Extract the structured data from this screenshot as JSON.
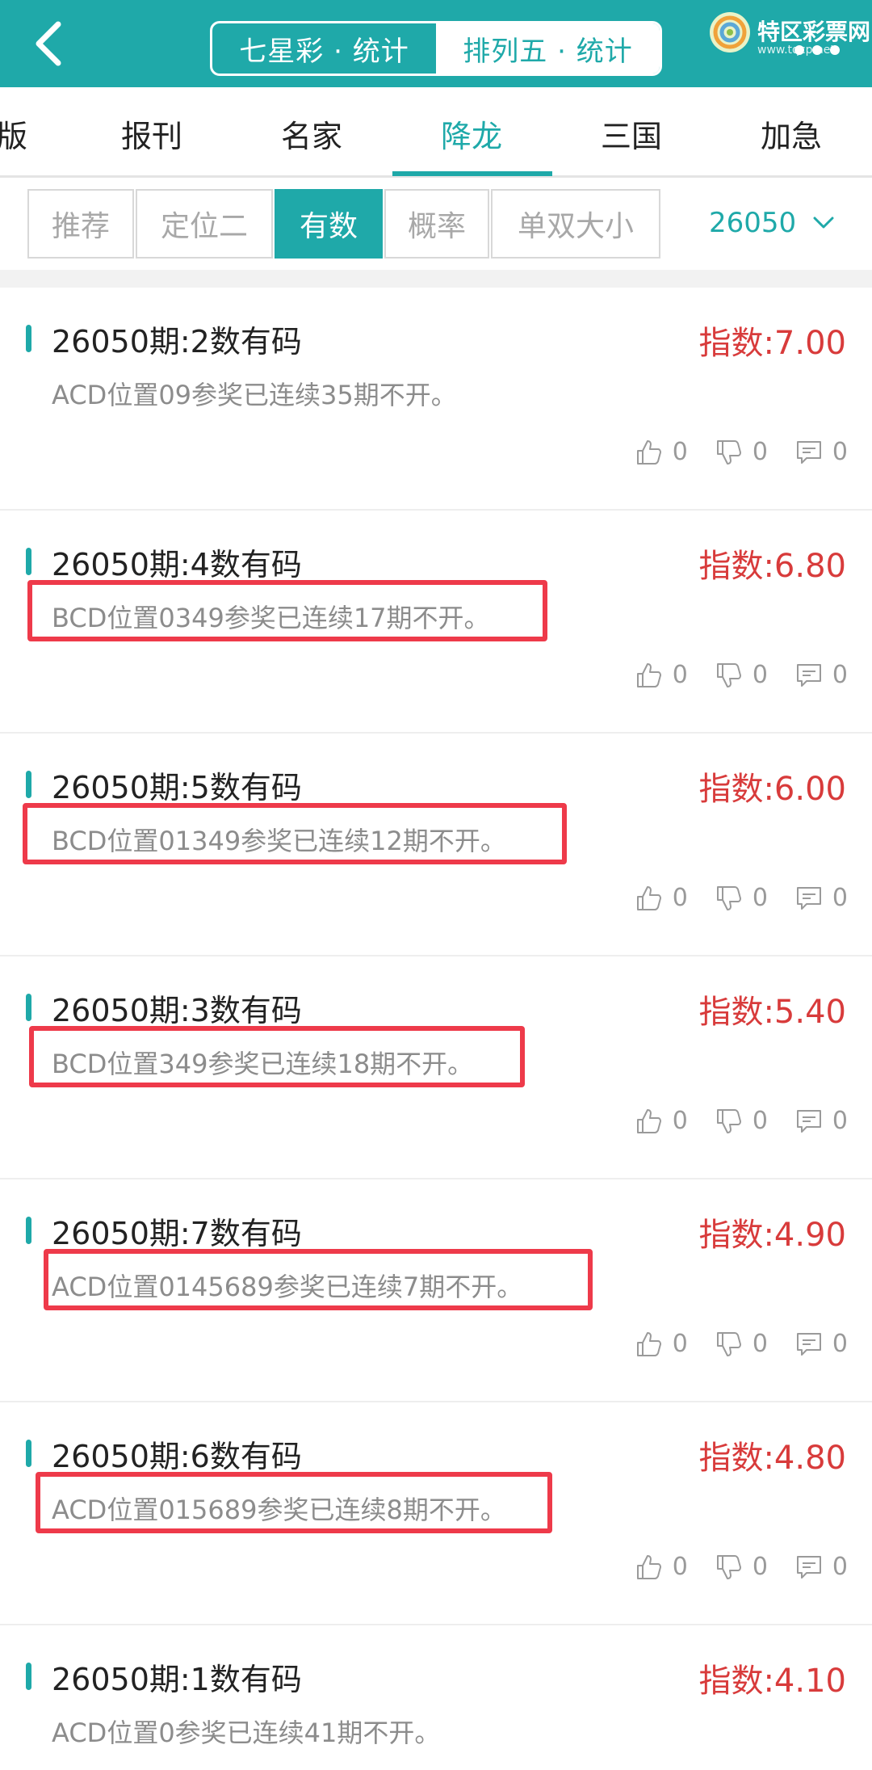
{
  "header": {
    "segments": [
      {
        "label": "七星彩 · 统计",
        "active": false
      },
      {
        "label": "排列五 · 统计",
        "active": true
      }
    ],
    "brand": {
      "name": "特区彩票网",
      "url": "www.tqcp.net"
    }
  },
  "nav": {
    "items": [
      "版",
      "报刊",
      "名家",
      "降龙",
      "三国",
      "加急"
    ],
    "active_index": 3
  },
  "filters": {
    "tabs": [
      "推荐",
      "定位二",
      "有数",
      "概率",
      "单双大小"
    ],
    "active_index": 2,
    "issue": "26050"
  },
  "colors": {
    "accent": "#1fa9a9",
    "index": "#d83b3b",
    "highlight": "#ee3a4a"
  },
  "items": [
    {
      "title": "26050期:2数有码",
      "index": "指数:7.00",
      "desc": "ACD位置09参奖已连续35期不开。",
      "likes": "0",
      "dislikes": "0",
      "comments": "0",
      "highlighted": false
    },
    {
      "title": "26050期:4数有码",
      "index": "指数:6.80",
      "desc": "BCD位置0349参奖已连续17期不开。",
      "likes": "0",
      "dislikes": "0",
      "comments": "0",
      "highlighted": true
    },
    {
      "title": "26050期:5数有码",
      "index": "指数:6.00",
      "desc": "BCD位置01349参奖已连续12期不开。",
      "likes": "0",
      "dislikes": "0",
      "comments": "0",
      "highlighted": true
    },
    {
      "title": "26050期:3数有码",
      "index": "指数:5.40",
      "desc": "BCD位置349参奖已连续18期不开。",
      "likes": "0",
      "dislikes": "0",
      "comments": "0",
      "highlighted": true
    },
    {
      "title": "26050期:7数有码",
      "index": "指数:4.90",
      "desc": "ACD位置0145689参奖已连续7期不开。",
      "likes": "0",
      "dislikes": "0",
      "comments": "0",
      "highlighted": true
    },
    {
      "title": "26050期:6数有码",
      "index": "指数:4.80",
      "desc": "ACD位置015689参奖已连续8期不开。",
      "likes": "0",
      "dislikes": "0",
      "comments": "0",
      "highlighted": true
    },
    {
      "title": "26050期:1数有码",
      "index": "指数:4.10",
      "desc": "ACD位置0参奖已连续41期不开。",
      "likes": "0",
      "dislikes": "0",
      "comments": "0",
      "highlighted": false
    }
  ]
}
